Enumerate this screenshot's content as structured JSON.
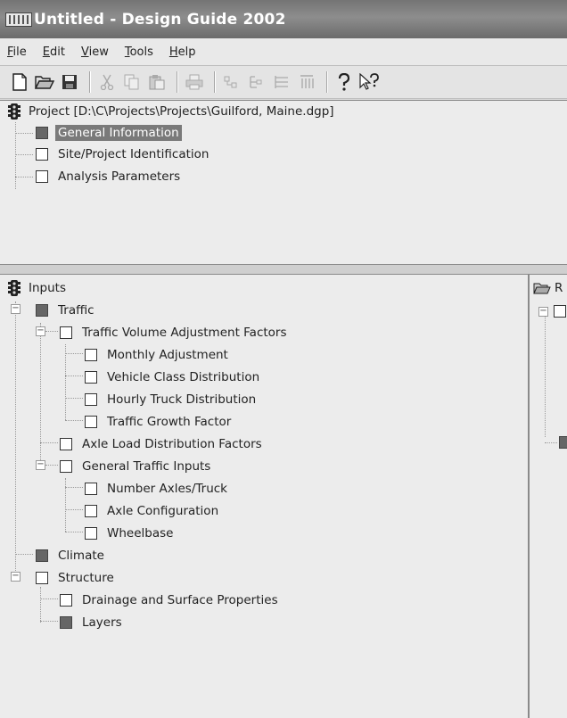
{
  "window": {
    "title": "Untitled - Design Guide 2002"
  },
  "menu": [
    {
      "pre": "",
      "u": "F",
      "post": "ile"
    },
    {
      "pre": "",
      "u": "E",
      "post": "dit"
    },
    {
      "pre": "",
      "u": "V",
      "post": "iew"
    },
    {
      "pre": "",
      "u": "T",
      "post": "ools"
    },
    {
      "pre": "",
      "u": "H",
      "post": "elp"
    }
  ],
  "toolbar": {
    "icons": [
      "new-icon",
      "open-icon",
      "save-icon",
      "cut-icon",
      "copy-icon",
      "paste-icon",
      "print-icon",
      "tree-icon-1",
      "tree-icon-2",
      "tree-icon-3",
      "tree-icon-4",
      "help-icon",
      "context-help-icon"
    ]
  },
  "project": {
    "root_label": "Project [D:\\C\\Projects\\Projects\\Guilford, Maine.dgp]",
    "items": [
      {
        "label": "General Information",
        "filled": true,
        "selected": true
      },
      {
        "label": "Site/Project Identification",
        "filled": false,
        "selected": false
      },
      {
        "label": "Analysis Parameters",
        "filled": false,
        "selected": false
      }
    ]
  },
  "inputs": {
    "root_label": "Inputs",
    "traffic": {
      "label": "Traffic",
      "volume_factors": "Traffic Volume Adjustment Factors",
      "monthly": "Monthly Adjustment",
      "vehicle_class": "Vehicle Class Distribution",
      "hourly_truck": "Hourly Truck Distribution",
      "growth": "Traffic Growth Factor",
      "axle_load": "Axle Load Distribution Factors",
      "general_inputs": "General Traffic Inputs",
      "axles_truck": "Number Axles/Truck",
      "axle_config": "Axle Configuration",
      "wheelbase": "Wheelbase"
    },
    "climate": "Climate",
    "structure": {
      "label": "Structure",
      "drainage": "Drainage and Surface Properties",
      "layers": "Layers"
    }
  },
  "right_panel": {
    "root_label": "R"
  },
  "colors": {
    "titlebar": "#7a7a7a",
    "selection": "#7a7a7a",
    "filled_box": "#666666"
  }
}
